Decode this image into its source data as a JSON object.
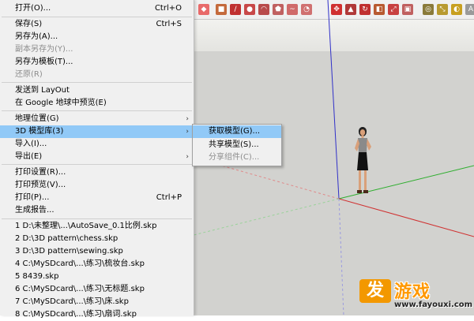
{
  "file_menu": {
    "open": {
      "label": "打开(O)...",
      "shortcut": "Ctrl+O"
    },
    "save": {
      "label": "保存(S)",
      "shortcut": "Ctrl+S"
    },
    "save_as": "另存为(A)...",
    "save_copy_as": "副本另存为(Y)...",
    "save_as_template": "另存为模板(T)...",
    "revert": "还原(R)",
    "send_to_layout": "发送到 LayOut",
    "preview_google_earth": "在 Google 地球中预览(E)",
    "geo_location": "地理位置(G)",
    "model_library": "3D 模型库(3)",
    "import": "导入(I)...",
    "export": "导出(E)",
    "print_setup": "打印设置(R)...",
    "print_preview": "打印预览(V)...",
    "print": {
      "label": "打印(P)...",
      "shortcut": "Ctrl+P"
    },
    "generate_report": "生成报告...",
    "recent_files": [
      "1 D:\\未整理\\...\\AutoSave_0.1比例.skp",
      "2 D:\\3D pattern\\chess.skp",
      "3 D:\\3D pattern\\sewing.skp",
      "4 C:\\MySDcard\\...\\练习\\梳妆台.skp",
      "5 8439.skp",
      "6 C:\\MySDcard\\...\\练习\\无标题.skp",
      "7 C:\\MySDcard\\...\\练习\\床.skp",
      "8 C:\\MySDcard\\...\\练习\\扇词.skp"
    ]
  },
  "submenu_3d": {
    "get_models": "获取模型(G)...",
    "share_model": "共享模型(S)...",
    "share_component": "分享组件(C)..."
  },
  "watermark": {
    "badge": "发",
    "text": "游戏",
    "url": "www.fayouxi.com"
  },
  "colors": {
    "highlight": "#91c9f7",
    "menu_bg": "#f0f0f0",
    "axis_red": "#d03030",
    "axis_green": "#2fae2f",
    "axis_blue": "#3030c8",
    "watermark_orange": "#f39800"
  }
}
